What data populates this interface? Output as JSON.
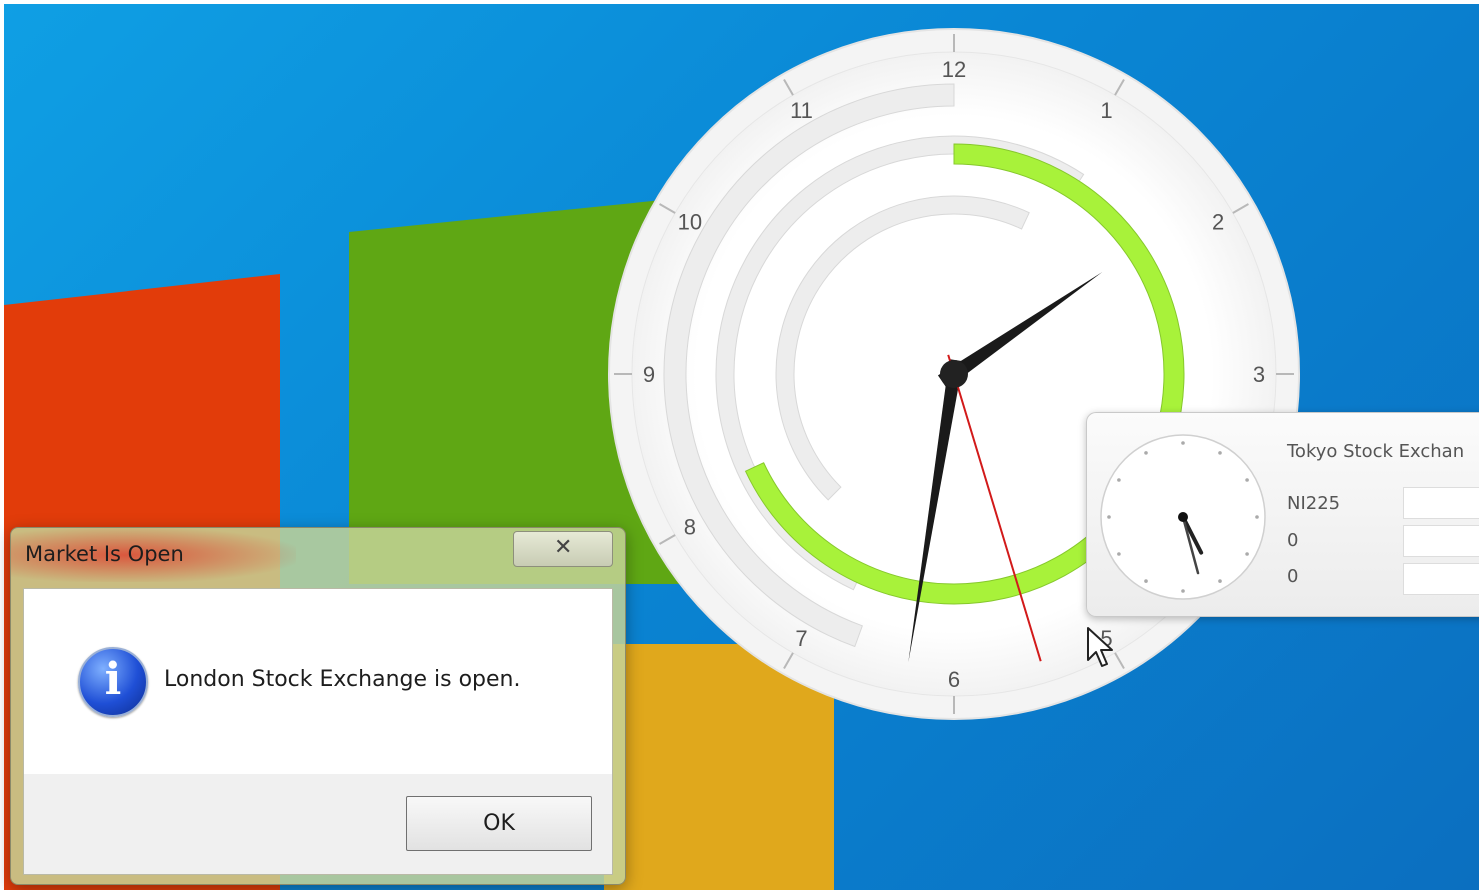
{
  "clock": {
    "numerals": [
      "12",
      "1",
      "2",
      "3",
      "",
      "5",
      "6",
      "7",
      "8",
      "9",
      "10",
      "11"
    ],
    "time": {
      "hour": 1.85,
      "minute": 31.5,
      "second": 27.2
    },
    "colors": {
      "session_open": "#a8f23a",
      "session_closed": "#ededed",
      "hand": "#1a1a1a",
      "second_hand": "#d21a1a"
    }
  },
  "tokyo": {
    "title": "Tokyo Stock Exchan",
    "index_name": "NI225",
    "value_1": "0",
    "value_2": "0",
    "mini_clock": {
      "hour": 5.1,
      "minute": 27.5
    }
  },
  "dialog": {
    "title": "Market Is Open",
    "close_glyph": "✕",
    "icon": "info-icon",
    "icon_glyph": "i",
    "message": "London Stock Exchange is open.",
    "ok_label": "OK"
  }
}
